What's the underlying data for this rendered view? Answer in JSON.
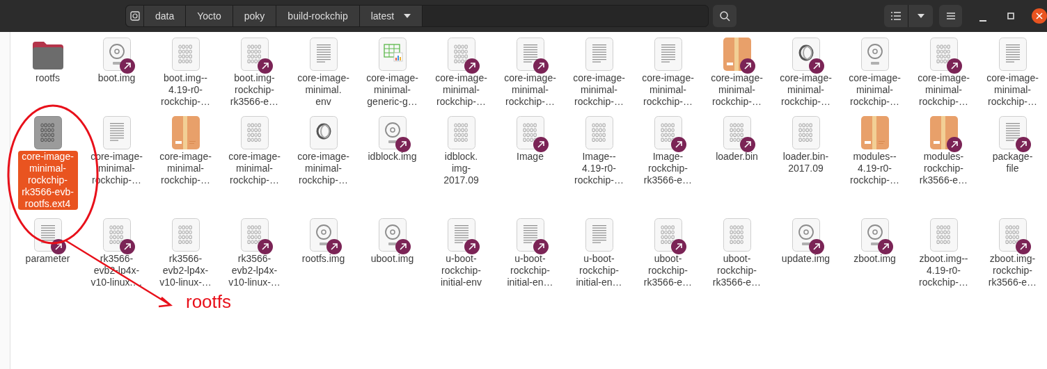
{
  "path_bar": {
    "segments": [
      "data",
      "Yocto",
      "poky",
      "build-rockchip",
      "latest"
    ]
  },
  "annotation": {
    "text": "rootfs"
  },
  "rows": [
    [
      {
        "kind": "folder",
        "link": false,
        "selected": false,
        "lines": [
          "rootfs"
        ]
      },
      {
        "kind": "disc",
        "link": true,
        "selected": false,
        "lines": [
          "boot.img"
        ]
      },
      {
        "kind": "binary",
        "link": false,
        "selected": false,
        "lines": [
          "boot.img--",
          "4.19-r0-",
          "rockchip-…"
        ]
      },
      {
        "kind": "binary",
        "link": true,
        "selected": false,
        "lines": [
          "boot.img-",
          "rockchip-",
          "rk3566-e…"
        ]
      },
      {
        "kind": "text",
        "link": false,
        "selected": false,
        "lines": [
          "core-image-",
          "minimal.",
          "env"
        ]
      },
      {
        "kind": "spreadsheet",
        "link": false,
        "selected": false,
        "lines": [
          "core-image-",
          "minimal-",
          "generic-g…"
        ]
      },
      {
        "kind": "binary",
        "link": true,
        "selected": false,
        "lines": [
          "core-image-",
          "minimal-",
          "rockchip-…"
        ]
      },
      {
        "kind": "text",
        "link": true,
        "selected": false,
        "lines": [
          "core-image-",
          "minimal-",
          "rockchip-…"
        ]
      },
      {
        "kind": "text",
        "link": false,
        "selected": false,
        "lines": [
          "core-image-",
          "minimal-",
          "rockchip-…"
        ]
      },
      {
        "kind": "text",
        "link": false,
        "selected": false,
        "lines": [
          "core-image-",
          "minimal-",
          "rockchip-…"
        ]
      },
      {
        "kind": "package",
        "link": true,
        "selected": false,
        "lines": [
          "core-image-",
          "minimal-",
          "rockchip-…"
        ]
      },
      {
        "kind": "json",
        "link": true,
        "selected": false,
        "lines": [
          "core-image-",
          "minimal-",
          "rockchip-…"
        ]
      },
      {
        "kind": "disc",
        "link": false,
        "selected": false,
        "lines": [
          "core-image-",
          "minimal-",
          "rockchip-…"
        ]
      },
      {
        "kind": "binary",
        "link": true,
        "selected": false,
        "lines": [
          "core-image-",
          "minimal-",
          "rockchip-…"
        ]
      },
      {
        "kind": "text",
        "link": false,
        "selected": false,
        "lines": [
          "core-image-",
          "minimal-",
          "rockchip-…"
        ]
      }
    ],
    [
      {
        "kind": "binary",
        "link": false,
        "selected": true,
        "lines": [
          "core-image-",
          "minimal-",
          "rockchip-",
          "rk3566-evb-",
          "rootfs.ext4"
        ]
      },
      {
        "kind": "text",
        "link": false,
        "selected": false,
        "lines": [
          "core-image-",
          "minimal-",
          "rockchip-…"
        ]
      },
      {
        "kind": "package",
        "link": false,
        "selected": false,
        "lines": [
          "core-image-",
          "minimal-",
          "rockchip-…"
        ]
      },
      {
        "kind": "binary",
        "link": false,
        "selected": false,
        "lines": [
          "core-image-",
          "minimal-",
          "rockchip-…"
        ]
      },
      {
        "kind": "json",
        "link": false,
        "selected": false,
        "lines": [
          "core-image-",
          "minimal-",
          "rockchip-…"
        ]
      },
      {
        "kind": "disc",
        "link": true,
        "selected": false,
        "lines": [
          "idblock.img"
        ]
      },
      {
        "kind": "binary",
        "link": false,
        "selected": false,
        "lines": [
          "idblock.",
          "img-",
          "2017.09"
        ]
      },
      {
        "kind": "binary",
        "link": true,
        "selected": false,
        "lines": [
          "Image"
        ]
      },
      {
        "kind": "binary",
        "link": false,
        "selected": false,
        "lines": [
          "Image--",
          "4.19-r0-",
          "rockchip-…"
        ]
      },
      {
        "kind": "binary",
        "link": true,
        "selected": false,
        "lines": [
          "Image-",
          "rockchip-",
          "rk3566-e…"
        ]
      },
      {
        "kind": "binary",
        "link": true,
        "selected": false,
        "lines": [
          "loader.bin"
        ]
      },
      {
        "kind": "binary",
        "link": false,
        "selected": false,
        "lines": [
          "loader.bin-",
          "2017.09"
        ]
      },
      {
        "kind": "package",
        "link": false,
        "selected": false,
        "lines": [
          "modules--",
          "4.19-r0-",
          "rockchip-…"
        ]
      },
      {
        "kind": "package",
        "link": true,
        "selected": false,
        "lines": [
          "modules-",
          "rockchip-",
          "rk3566-e…"
        ]
      },
      {
        "kind": "text",
        "link": true,
        "selected": false,
        "lines": [
          "package-",
          "file"
        ]
      }
    ],
    [
      {
        "kind": "text",
        "link": true,
        "selected": false,
        "lines": [
          "parameter"
        ]
      },
      {
        "kind": "binary",
        "link": true,
        "selected": false,
        "lines": [
          "rk3566-",
          "evb2-lp4x-",
          "v10-linux.…"
        ]
      },
      {
        "kind": "binary",
        "link": false,
        "selected": false,
        "lines": [
          "rk3566-",
          "evb2-lp4x-",
          "v10-linux-…"
        ]
      },
      {
        "kind": "binary",
        "link": true,
        "selected": false,
        "lines": [
          "rk3566-",
          "evb2-lp4x-",
          "v10-linux-…"
        ]
      },
      {
        "kind": "disc",
        "link": true,
        "selected": false,
        "lines": [
          "rootfs.img"
        ]
      },
      {
        "kind": "disc",
        "link": true,
        "selected": false,
        "lines": [
          "uboot.img"
        ]
      },
      {
        "kind": "text",
        "link": true,
        "selected": false,
        "lines": [
          "u-boot-",
          "rockchip-",
          "initial-env"
        ]
      },
      {
        "kind": "text",
        "link": true,
        "selected": false,
        "lines": [
          "u-boot-",
          "rockchip-",
          "initial-en…"
        ]
      },
      {
        "kind": "text",
        "link": false,
        "selected": false,
        "lines": [
          "u-boot-",
          "rockchip-",
          "initial-en…"
        ]
      },
      {
        "kind": "binary",
        "link": true,
        "selected": false,
        "lines": [
          "uboot-",
          "rockchip-",
          "rk3566-e…"
        ]
      },
      {
        "kind": "binary",
        "link": false,
        "selected": false,
        "lines": [
          "uboot-",
          "rockchip-",
          "rk3566-e…"
        ]
      },
      {
        "kind": "disc",
        "link": true,
        "selected": false,
        "lines": [
          "update.img"
        ]
      },
      {
        "kind": "disc",
        "link": true,
        "selected": false,
        "lines": [
          "zboot.img"
        ]
      },
      {
        "kind": "binary",
        "link": false,
        "selected": false,
        "lines": [
          "zboot.img--",
          "4.19-r0-",
          "rockchip-…"
        ]
      },
      {
        "kind": "binary",
        "link": true,
        "selected": false,
        "lines": [
          "zboot.img-",
          "rockchip-",
          "rk3566-e…"
        ]
      }
    ]
  ]
}
